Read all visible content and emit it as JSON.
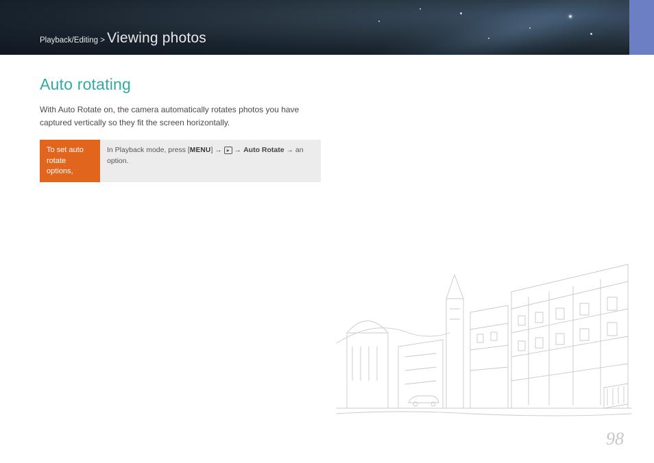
{
  "header": {
    "breadcrumb_section": "Playback/Editing",
    "breadcrumb_sep": " > ",
    "breadcrumb_title": "Viewing photos"
  },
  "section": {
    "title": "Auto rotating",
    "description": "With Auto Rotate on, the camera automatically rotates photos you have captured vertically so they fit the screen horizontally."
  },
  "instruction": {
    "label": "To set auto rotate options,",
    "body_prefix": "In Playback mode, press [",
    "menu_text": "MENU",
    "arrow": " → ",
    "play_glyph": "▸",
    "target": "Auto Rotate",
    "body_suffix": " → an option."
  },
  "page_number": "98"
}
